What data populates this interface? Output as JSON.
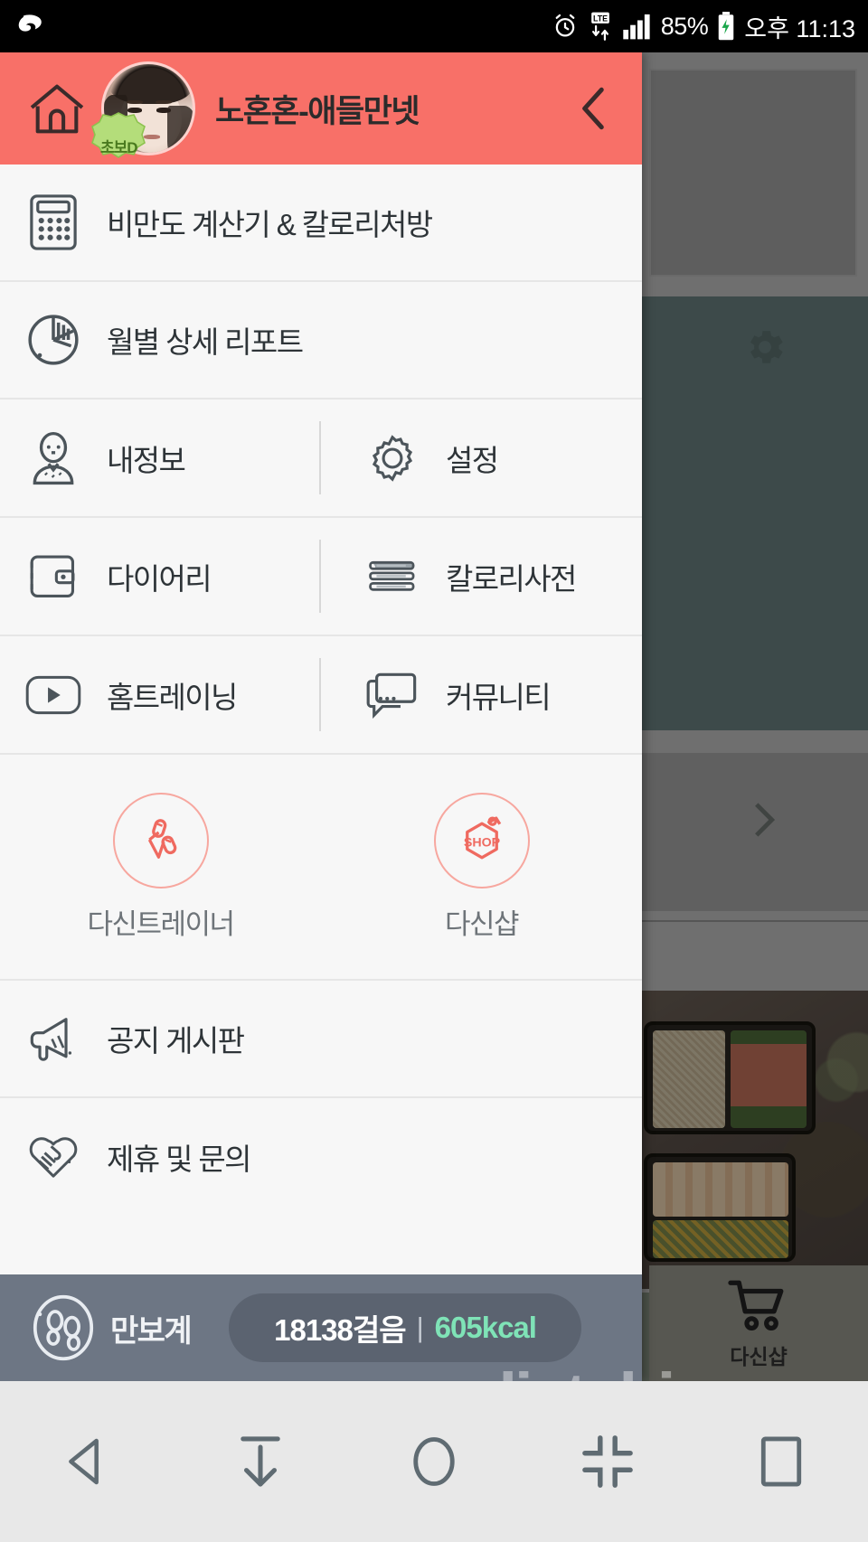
{
  "statusbar": {
    "carrier_icon": "carrier-logo-icon",
    "alarm_icon": "alarm-clock-icon",
    "network_label": "LTE",
    "signal_icon": "signal-bars-icon",
    "battery_percent": "85%",
    "battery_icon": "battery-charging-icon",
    "clock": "오후 11:13"
  },
  "drawer": {
    "home_icon": "home-icon",
    "avatar": "user-avatar",
    "badge_label": "초보D",
    "username": "노혼혼-애들만넷",
    "back_icon": "chevron-left-icon",
    "full_rows": [
      {
        "icon": "calculator-icon",
        "label": "비만도 계산기 & 칼로리처방"
      },
      {
        "icon": "pie-chart-icon",
        "label": "월별 상세 리포트"
      }
    ],
    "split_rows": [
      {
        "left": {
          "icon": "person-icon",
          "label": "내정보"
        },
        "right": {
          "icon": "gear-icon",
          "label": "설정"
        }
      },
      {
        "left": {
          "icon": "wallet-icon",
          "label": "다이어리"
        },
        "right": {
          "icon": "book-stack-icon",
          "label": "칼로리사전"
        }
      },
      {
        "left": {
          "icon": "play-button-icon",
          "label": "홈트레이닝"
        },
        "right": {
          "icon": "chat-bubble-icon",
          "label": "커뮤니티"
        }
      }
    ],
    "promo": [
      {
        "icon": "dumbbell-trainer-icon",
        "label": "다신트레이너"
      },
      {
        "icon": "shop-tag-icon",
        "label": "다신샵"
      }
    ],
    "bottom_rows": [
      {
        "icon": "megaphone-icon",
        "label": "공지 게시판"
      },
      {
        "icon": "handshake-heart-icon",
        "label": "제휴 및 문의"
      }
    ],
    "pedometer": {
      "icon": "footprints-icon",
      "label": "만보계",
      "steps": "18138걸음",
      "separator": "|",
      "calories": "605kcal"
    }
  },
  "background": {
    "gear_icon": "gear-icon",
    "chevron_icon": "chevron-right-icon",
    "shop_tab": {
      "icon": "shopping-cart-icon",
      "label": "다신샵"
    },
    "watermark": "dietshin.com"
  },
  "navbar": {
    "buttons": [
      {
        "icon": "back-triangle-icon"
      },
      {
        "icon": "download-arrow-icon"
      },
      {
        "icon": "home-circle-icon"
      },
      {
        "icon": "shrink-icon"
      },
      {
        "icon": "recents-square-icon"
      }
    ]
  },
  "colors": {
    "accent": "#f87068",
    "promo_outline": "#f7a79f",
    "pedometer_bg": "#6d7684",
    "kcal_green": "#7fe3b7",
    "badge_green": "#a8d46a"
  }
}
